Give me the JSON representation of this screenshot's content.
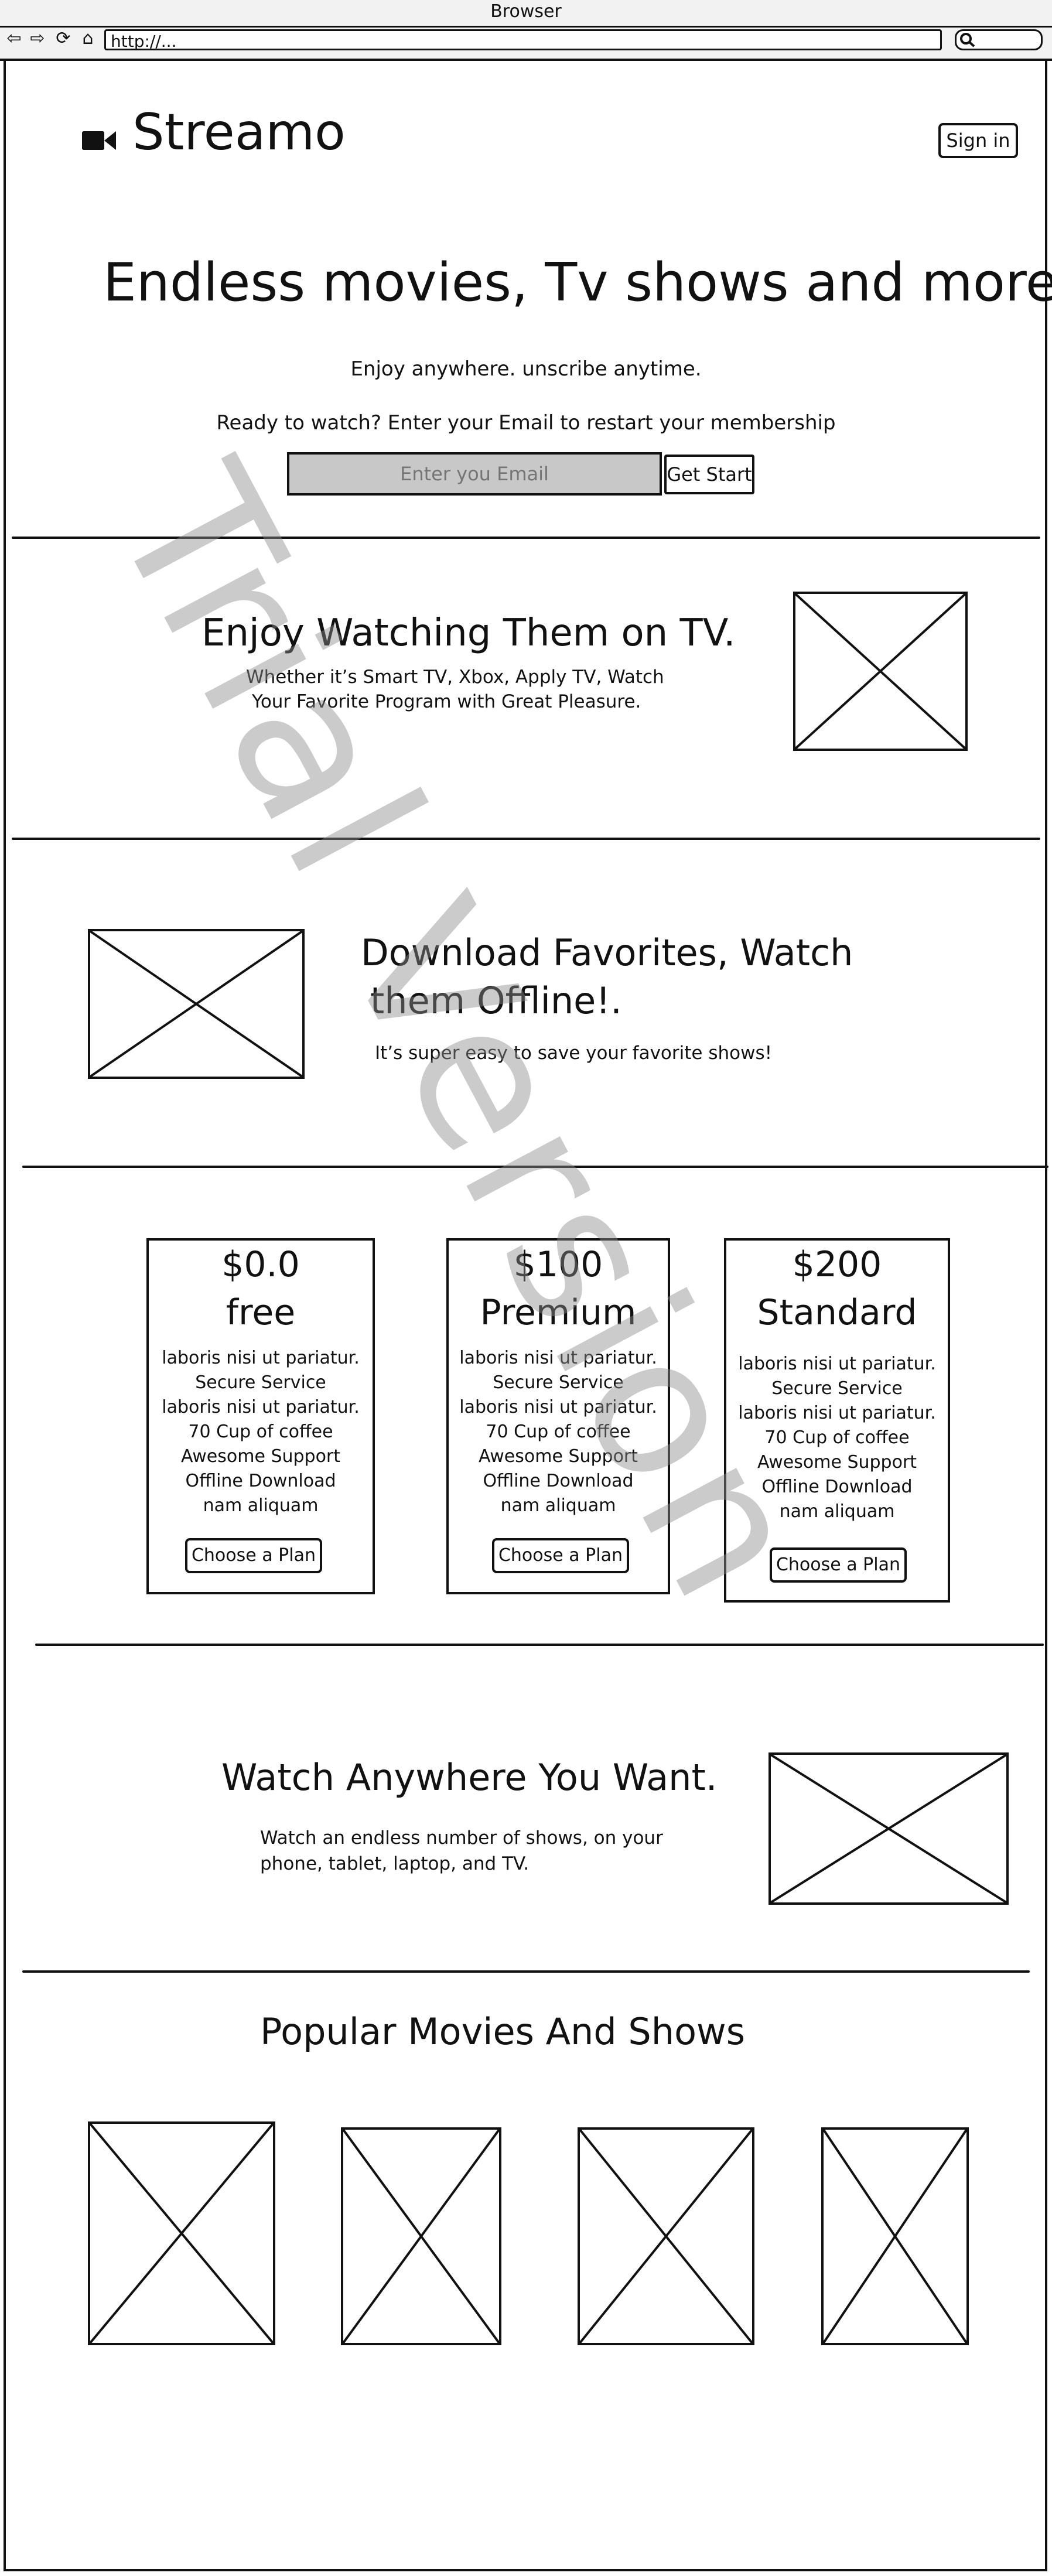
{
  "browser": {
    "title": "Browser",
    "url": "http://...",
    "nav_icons": [
      "back-arrow-icon",
      "forward-arrow-icon",
      "refresh-icon",
      "home-icon"
    ],
    "search_icon": "magnifier-icon"
  },
  "header": {
    "logo_icon": "video-camera-icon",
    "brand": "Streamo",
    "signin_label": "Sign in"
  },
  "hero": {
    "title": "Endless movies, Tv shows and more",
    "subtitle": "Enjoy anywhere. unscribe anytime.",
    "prompt": "Ready to watch? Enter your Email to restart your membership",
    "email_placeholder": "Enter you Email",
    "cta_label": "Get Start"
  },
  "tv_section": {
    "title": "Enjoy Watching Them on TV.",
    "desc_lines": [
      "Whether it’s Smart TV, Xbox, Apply TV, Watch",
      "Your Favorite Program with Great Pleasure."
    ]
  },
  "download_section": {
    "title_lines": [
      "Download Favorites, Watch",
      "them Offline!."
    ],
    "desc": "It’s super easy to save your favorite shows!"
  },
  "plans": [
    {
      "price": "$0.0",
      "name": "free",
      "features": [
        "laboris nisi ut pariatur.",
        "Secure Service",
        "laboris nisi ut pariatur.",
        "70 Cup of coffee",
        "Awesome Support",
        "Offline Download",
        "nam aliquam"
      ],
      "button": "Choose a Plan"
    },
    {
      "price": "$100",
      "name": "Premium",
      "features": [
        "laboris nisi ut  pariatur.",
        "Secure Service",
        "laboris nisi ut pariatur.",
        "70 Cup of coffee",
        "Awesome Support",
        "Offline Download",
        "nam aliquam"
      ],
      "button": "Choose a Plan"
    },
    {
      "price": "$200",
      "name": "Standard",
      "features": [
        "laboris nisi ut pariatur.",
        "Secure Service",
        "laboris nisi ut pariatur.",
        "70 Cup of coffee",
        "Awesome Support",
        "Offline Download",
        "nam aliquam"
      ],
      "button": "Choose a Plan"
    }
  ],
  "anywhere_section": {
    "title": "Watch Anywhere You Want.",
    "desc_lines": [
      "Watch an endless number of shows, on your",
      "phone, tablet, laptop, and TV."
    ]
  },
  "popular": {
    "title": "Popular Movies And Shows",
    "count": 4
  },
  "watermark": "Trial Version"
}
